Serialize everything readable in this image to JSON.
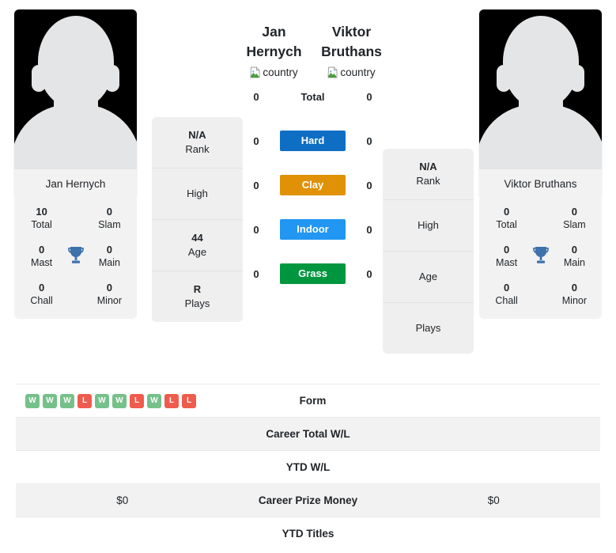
{
  "players": {
    "left": {
      "name": "Jan Hernych",
      "photo_caption": "Jan Hernych",
      "country_alt": "country",
      "titles": [
        {
          "value": "10",
          "label": "Total"
        },
        {
          "value": "0",
          "label": "Slam"
        },
        {
          "value": "0",
          "label": "Mast"
        },
        {
          "value": "0",
          "label": "Main"
        },
        {
          "value": "0",
          "label": "Chall"
        },
        {
          "value": "0",
          "label": "Minor"
        }
      ],
      "info": [
        {
          "value": "N/A",
          "label": "Rank"
        },
        {
          "value": "",
          "label": "High"
        },
        {
          "value": "44",
          "label": "Age"
        },
        {
          "value": "R",
          "label": "Plays"
        }
      ],
      "form": [
        "W",
        "W",
        "W",
        "L",
        "W",
        "W",
        "L",
        "W",
        "L",
        "L"
      ],
      "career_total_wl": "",
      "ytd_wl": "",
      "career_prize_money": "$0",
      "ytd_titles": ""
    },
    "right": {
      "name": "Viktor Bruthans",
      "photo_caption": "Viktor Bruthans",
      "country_alt": "country",
      "titles": [
        {
          "value": "0",
          "label": "Total"
        },
        {
          "value": "0",
          "label": "Slam"
        },
        {
          "value": "0",
          "label": "Mast"
        },
        {
          "value": "0",
          "label": "Main"
        },
        {
          "value": "0",
          "label": "Chall"
        },
        {
          "value": "0",
          "label": "Minor"
        }
      ],
      "info": [
        {
          "value": "N/A",
          "label": "Rank"
        },
        {
          "value": "",
          "label": "High"
        },
        {
          "value": "",
          "label": "Age"
        },
        {
          "value": "",
          "label": "Plays"
        }
      ],
      "form": [],
      "career_total_wl": "",
      "ytd_wl": "",
      "career_prize_money": "$0",
      "ytd_titles": ""
    }
  },
  "head_to_head": {
    "rows": [
      {
        "label": "Total",
        "left": "0",
        "right": "0",
        "pill": false,
        "color": ""
      },
      {
        "label": "Hard",
        "left": "0",
        "right": "0",
        "pill": true,
        "color": "#0d6ec4"
      },
      {
        "label": "Clay",
        "left": "0",
        "right": "0",
        "pill": true,
        "color": "#e09106"
      },
      {
        "label": "Indoor",
        "left": "0",
        "right": "0",
        "pill": true,
        "color": "#2196f3"
      },
      {
        "label": "Grass",
        "left": "0",
        "right": "0",
        "pill": true,
        "color": "#00963f"
      }
    ]
  },
  "comparison_table": {
    "rows": [
      {
        "label": "Form",
        "left_type": "form",
        "left": "",
        "right": "",
        "shaded": false
      },
      {
        "label": "Career Total W/L",
        "left_type": "text",
        "left": "",
        "right": "",
        "shaded": true
      },
      {
        "label": "YTD W/L",
        "left_type": "text",
        "left": "",
        "right": "",
        "shaded": false
      },
      {
        "label": "Career Prize Money",
        "left_type": "text",
        "left": "$0",
        "right": "$0",
        "shaded": true
      },
      {
        "label": "YTD Titles",
        "left_type": "text",
        "left": "",
        "right": "",
        "shaded": false
      }
    ]
  },
  "icons": {
    "trophy": "trophy-icon",
    "broken_image": "broken-image-icon"
  },
  "colors": {
    "hard": "#0d6ec4",
    "clay": "#e09106",
    "indoor": "#2196f3",
    "grass": "#00963f",
    "win_badge": "#76c08a",
    "loss_badge": "#ef5b4c",
    "panel_bg": "#f2f2f2",
    "trophy": "#3d72ac"
  }
}
